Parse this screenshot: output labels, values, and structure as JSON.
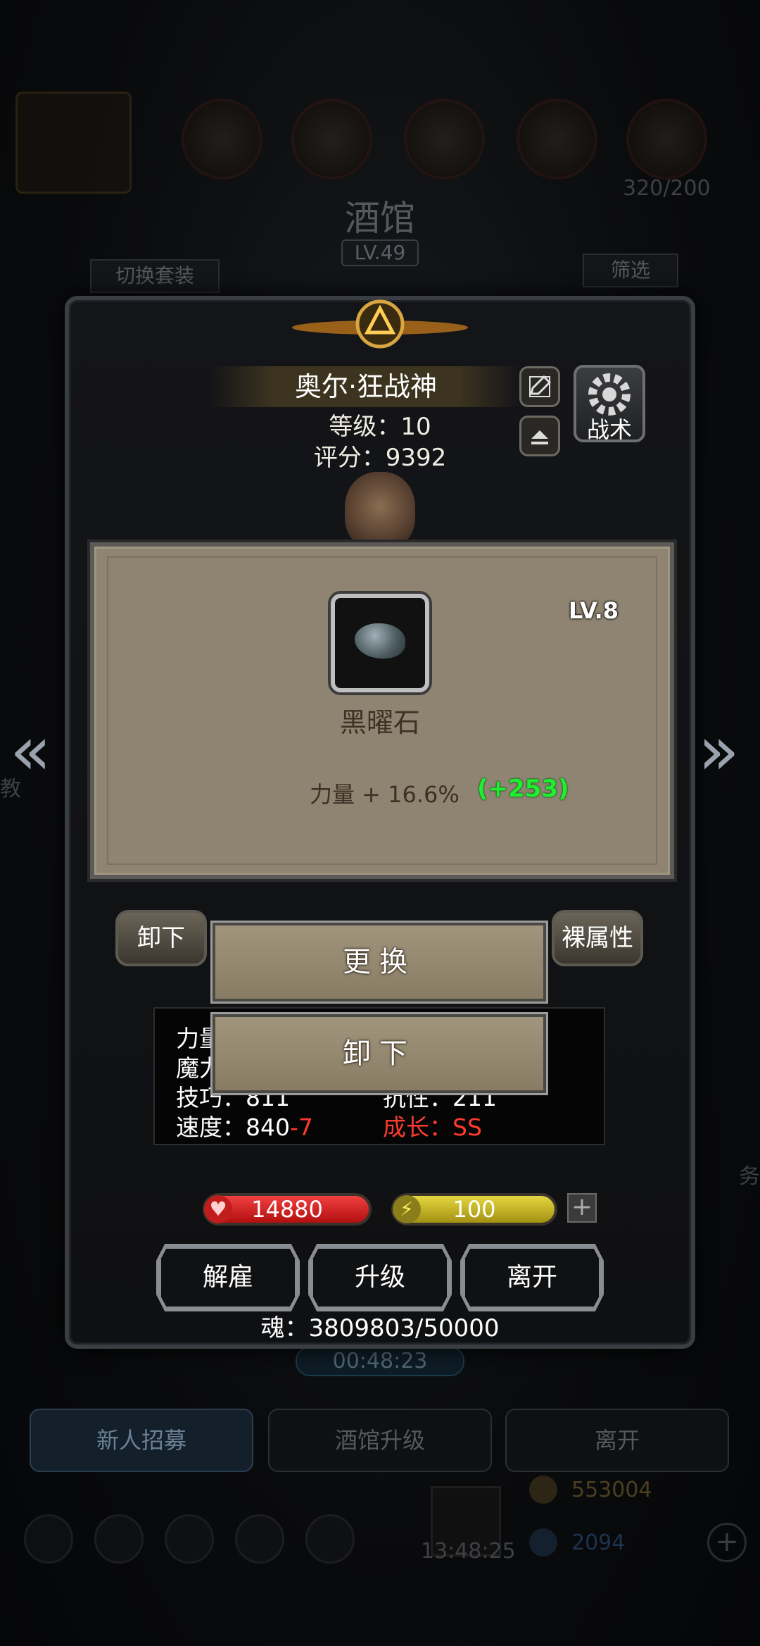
{
  "background": {
    "title": "酒馆",
    "level": "LV.49",
    "switch_set_label": "切换套装",
    "filter_label": "筛选",
    "top_counter": "320/200",
    "timer": "00:48:23",
    "tabs": [
      "新人招募",
      "酒馆升级",
      "离开"
    ],
    "clock": "13:48:25",
    "gold": "553004",
    "gems": "2094",
    "side_left_text": "教",
    "side_right_text": "务"
  },
  "hero": {
    "name": "奥尔·狂战神",
    "level_text": "等级：10",
    "score_text": "评分：9392",
    "tactic_label": "战术"
  },
  "item_popup": {
    "level": "LV.8",
    "name": "黑曜石",
    "attribute": "力量 + 16.6%",
    "bonus": "(+253)",
    "replace_label": "更换",
    "unequip_label": "卸下"
  },
  "side_buttons": {
    "unequip": "卸下",
    "base_attr": "裸属性"
  },
  "stats": {
    "row1_left": "力量",
    "row2_left": "魔力",
    "row3_left": "技巧：811",
    "row3_right": "抗性：211",
    "speed_label": "速度：840",
    "speed_delta": "-7",
    "growth": "成长：SS"
  },
  "bars": {
    "hp": "14880",
    "energy": "100"
  },
  "actions": {
    "dismiss": "解雇",
    "upgrade": "升级",
    "leave": "离开"
  },
  "soul_text": "魂：3809803/50000",
  "colors": {
    "bonus_green": "#1eef2e",
    "delta_red": "#ff3b2f",
    "card_bg": "#8e8471"
  }
}
